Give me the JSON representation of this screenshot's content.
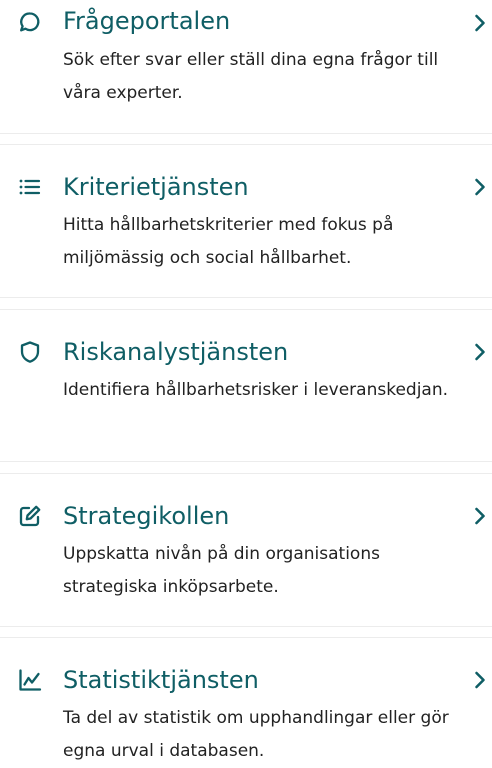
{
  "services": [
    {
      "title": "Frågeportalen",
      "description": "Sök efter svar eller ställ dina egna frågor till våra experter.",
      "icon": "chat-bubble-icon"
    },
    {
      "title": "Kriterietjänsten",
      "description": "Hitta hållbarhetskriterier med fokus på miljömässig och social hållbarhet.",
      "icon": "list-icon"
    },
    {
      "title": "Riskanalystjänsten",
      "description": "Identifiera hållbarhetsrisker i leveranskedjan.",
      "icon": "shield-icon"
    },
    {
      "title": "Strategikollen",
      "description": "Uppskatta nivån på din organisations strategiska inköpsarbete.",
      "icon": "edit-icon"
    },
    {
      "title": "Statistiktjänsten",
      "description": "Ta del av statistik om upphandlingar eller gör egna urval i databasen.",
      "icon": "line-chart-icon"
    }
  ],
  "colors": {
    "accent": "#0f5e65",
    "text": "#222222",
    "divider": "#ececec"
  }
}
